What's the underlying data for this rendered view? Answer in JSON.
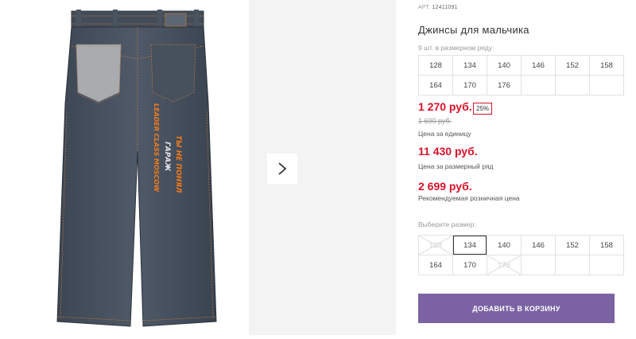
{
  "product": {
    "sku_label": "АРТ.",
    "sku_value": "12411091",
    "title": "Джинсы для мальчика",
    "image_text_orange_1": "ТЫ НЕ ПОНЯЛ",
    "image_text_orange_2": "LEADER CLASS MOSCOW",
    "image_text_white": "ГАРАЖ"
  },
  "size_range": {
    "caption": "9 шт. в размерном ряду",
    "sizes": [
      "128",
      "134",
      "140",
      "146",
      "152",
      "158",
      "164",
      "170",
      "176"
    ]
  },
  "prices": {
    "unit_price": "1 270 руб.",
    "discount": "25%",
    "old_price": "1 690 руб.",
    "unit_label": "Цена за единицу",
    "range_price": "11 430 руб.",
    "range_label": "Цена за размерный ряд",
    "rrp_price": "2 699 руб.",
    "rrp_label": "Рекомендуемая розничная цена"
  },
  "size_select": {
    "caption": "Выберите размер:",
    "sizes": [
      {
        "label": "128",
        "state": "disabled"
      },
      {
        "label": "134",
        "state": "selected"
      },
      {
        "label": "140",
        "state": "available"
      },
      {
        "label": "146",
        "state": "available"
      },
      {
        "label": "152",
        "state": "available"
      },
      {
        "label": "158",
        "state": "available"
      },
      {
        "label": "164",
        "state": "available"
      },
      {
        "label": "170",
        "state": "available"
      },
      {
        "label": "176",
        "state": "disabled"
      }
    ]
  },
  "actions": {
    "add_to_cart": "ДОБАВИТЬ В КОРЗИНУ"
  },
  "icons": {
    "next": "chevron-right-icon"
  },
  "colors": {
    "price_red": "#d6122a",
    "button_purple": "#7a62a3",
    "denim": "#4a5563"
  }
}
